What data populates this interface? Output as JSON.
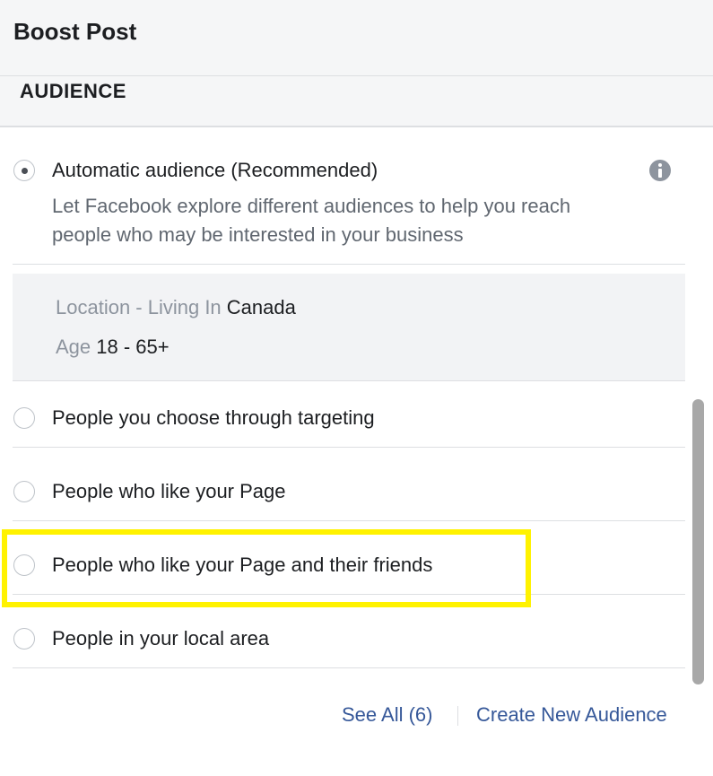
{
  "header": {
    "title": "Boost Post"
  },
  "section": {
    "title": "AUDIENCE"
  },
  "automatic": {
    "label": "Automatic audience (Recommended)",
    "description_line1": "Let Facebook explore different audiences to help you reach",
    "description_line2": "people who may be interested in your business",
    "selected": true,
    "icon": "info-icon"
  },
  "details": {
    "location_key": "Location - Living In",
    "location_value": "Canada",
    "age_key": "Age",
    "age_value": "18 - 65+"
  },
  "options": [
    {
      "label": "People you choose through targeting",
      "selected": false
    },
    {
      "label": "People who like your Page",
      "selected": false
    },
    {
      "label": "People who like your Page and their friends",
      "selected": false,
      "highlighted": true
    },
    {
      "label": "People in your local area",
      "selected": false
    }
  ],
  "footer": {
    "see_all": "See All (6)",
    "separator": "|",
    "create_new": "Create New Audience"
  },
  "colors": {
    "highlight": "#fff200",
    "link": "#365899",
    "header_bg": "#f5f6f7"
  }
}
